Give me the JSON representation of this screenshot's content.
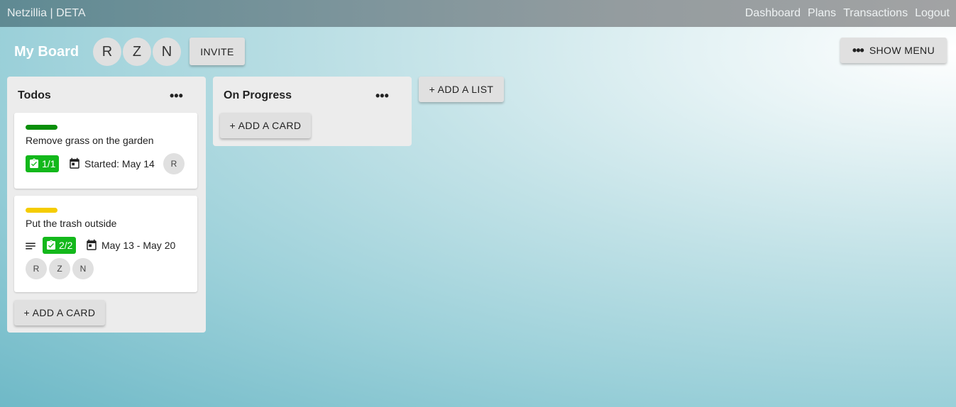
{
  "app": {
    "title": "Netzillia | DETA"
  },
  "nav": {
    "dashboard": "Dashboard",
    "plans": "Plans",
    "transactions": "Transactions",
    "logout": "Logout"
  },
  "board": {
    "title": "My Board",
    "members": [
      "R",
      "Z",
      "N"
    ],
    "invite_label": "INVITE",
    "show_menu_label": "SHOW MENU",
    "add_list_label": "+ ADD A LIST"
  },
  "lists": [
    {
      "title": "Todos",
      "add_card_label": "+ ADD A CARD",
      "cards": [
        {
          "label_color": "#0a8f0a",
          "title": "Remove grass on the garden",
          "checklist": "1/1",
          "date": "Started: May 14",
          "members": [
            "R"
          ],
          "has_description": false
        },
        {
          "label_color": "#f5cc00",
          "title": "Put the trash outside",
          "checklist": "2/2",
          "date": "May 13 - May 20",
          "members": [
            "R",
            "Z",
            "N"
          ],
          "has_description": true
        }
      ]
    },
    {
      "title": "On Progress",
      "add_card_label": "+ ADD A CARD",
      "cards": []
    }
  ],
  "colors": {
    "badge_green": "#13b81b",
    "button_gray": "#e0e0e0"
  }
}
